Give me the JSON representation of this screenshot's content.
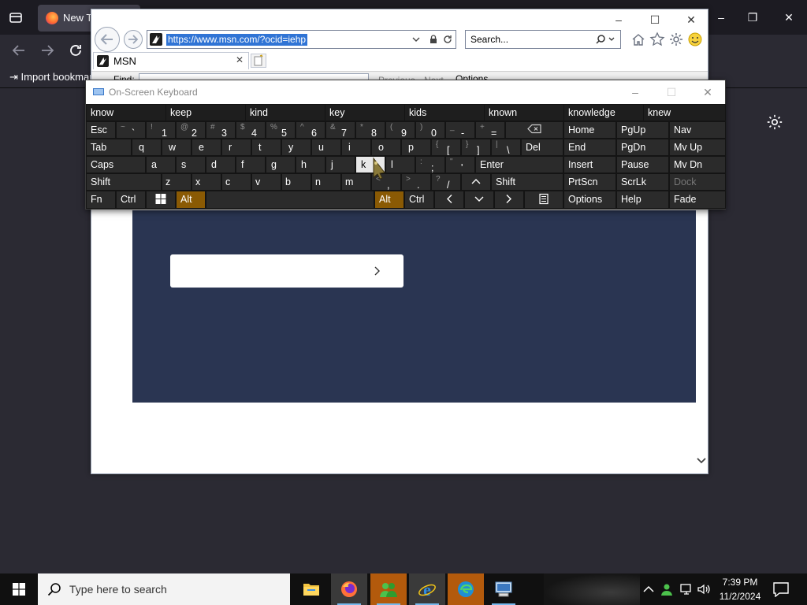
{
  "firefox": {
    "tab_label": "New Tab",
    "import_bookmarks": "Import bookmarks..."
  },
  "ie": {
    "url": "https://www.msn.com/?ocid=iehp",
    "search_placeholder": "Search...",
    "tab_label": "MSN",
    "tab_close": "✕",
    "find_label": "Find:",
    "find_previous": "Previous",
    "find_next": "Next",
    "find_options": "Options"
  },
  "osk": {
    "title": "On-Screen Keyboard",
    "predictions": [
      "know",
      "keep",
      "kind",
      "key",
      "kids",
      "known",
      "knowledge",
      "knew"
    ],
    "row1": [
      {
        "id": "esc",
        "label": "Esc"
      },
      {
        "id": "backtick",
        "shift": "~",
        "main": "`"
      },
      {
        "id": "1",
        "shift": "!",
        "main": "1"
      },
      {
        "id": "2",
        "shift": "@",
        "main": "2"
      },
      {
        "id": "3",
        "shift": "#",
        "main": "3"
      },
      {
        "id": "4",
        "shift": "$",
        "main": "4"
      },
      {
        "id": "5",
        "shift": "%",
        "main": "5"
      },
      {
        "id": "6",
        "shift": "^",
        "main": "6"
      },
      {
        "id": "7",
        "shift": "&",
        "main": "7"
      },
      {
        "id": "8",
        "shift": "*",
        "main": "8"
      },
      {
        "id": "9",
        "shift": "(",
        "main": "9"
      },
      {
        "id": "0",
        "shift": ")",
        "main": "0"
      },
      {
        "id": "minus",
        "shift": "_",
        "main": "-"
      },
      {
        "id": "equals",
        "shift": "+",
        "main": "="
      }
    ],
    "row2": {
      "tab": "Tab",
      "letters": [
        "q",
        "w",
        "e",
        "r",
        "t",
        "y",
        "u",
        "i",
        "o",
        "p"
      ],
      "lbracket": {
        "shift": "{",
        "main": "["
      },
      "rbracket": {
        "shift": "}",
        "main": "]"
      },
      "backslash": {
        "shift": "|",
        "main": "\\"
      },
      "del": "Del"
    },
    "row3": {
      "caps": "Caps",
      "letters": [
        "a",
        "s",
        "d",
        "f",
        "g",
        "h",
        "j",
        "k",
        "l"
      ],
      "semicolon": {
        "shift": ":",
        "main": ";"
      },
      "quote": {
        "shift": "\"",
        "main": "'"
      },
      "enter": "Enter"
    },
    "row4": {
      "shift_left": "Shift",
      "letters": [
        "z",
        "x",
        "c",
        "v",
        "b",
        "n",
        "m"
      ],
      "comma": {
        "shift": "<",
        "main": ","
      },
      "period": {
        "shift": ">",
        "main": "."
      },
      "slash": {
        "shift": "?",
        "main": "/"
      },
      "shift_right": "Shift"
    },
    "row5": {
      "fn": "Fn",
      "ctrl_left": "Ctrl",
      "alt_left": "Alt",
      "alt_right": "Alt",
      "ctrl_right": "Ctrl"
    },
    "nav": {
      "home": "Home",
      "pgup": "PgUp",
      "nav": "Nav",
      "end": "End",
      "pgdn": "PgDn",
      "mvup": "Mv Up",
      "insert": "Insert",
      "pause": "Pause",
      "mvdn": "Mv Dn",
      "prtscn": "PrtScn",
      "scrlk": "ScrLk",
      "dock": "Dock",
      "options": "Options",
      "help": "Help",
      "fade": "Fade"
    },
    "colors": {
      "alt_active": "#8a5a04",
      "key_bg": "#2b2b2b"
    }
  },
  "taskbar": {
    "search_placeholder": "Type here to search",
    "time": "7:39 PM",
    "date": "11/2/2024"
  }
}
